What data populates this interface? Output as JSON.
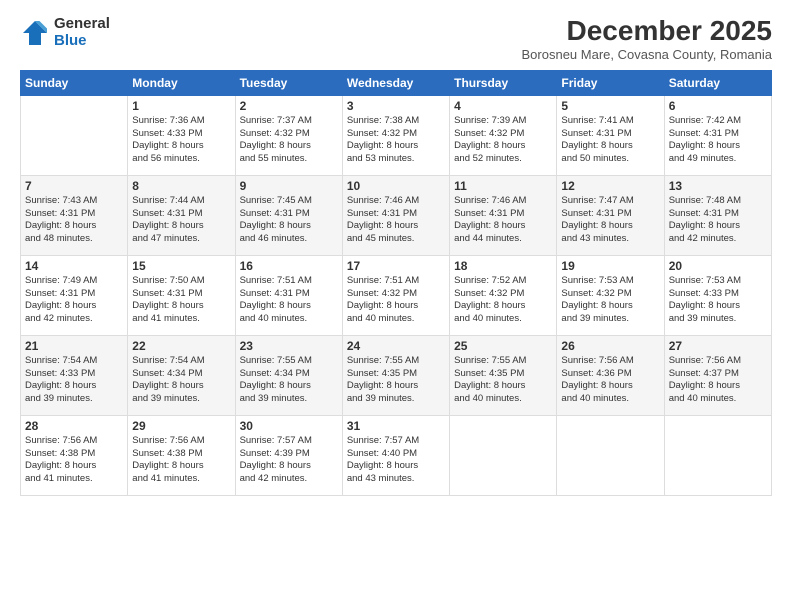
{
  "logo": {
    "general": "General",
    "blue": "Blue"
  },
  "header": {
    "month": "December 2025",
    "location": "Borosneu Mare, Covasna County, Romania"
  },
  "weekdays": [
    "Sunday",
    "Monday",
    "Tuesday",
    "Wednesday",
    "Thursday",
    "Friday",
    "Saturday"
  ],
  "weeks": [
    [
      {
        "day": "",
        "info": ""
      },
      {
        "day": "1",
        "info": "Sunrise: 7:36 AM\nSunset: 4:33 PM\nDaylight: 8 hours\nand 56 minutes."
      },
      {
        "day": "2",
        "info": "Sunrise: 7:37 AM\nSunset: 4:32 PM\nDaylight: 8 hours\nand 55 minutes."
      },
      {
        "day": "3",
        "info": "Sunrise: 7:38 AM\nSunset: 4:32 PM\nDaylight: 8 hours\nand 53 minutes."
      },
      {
        "day": "4",
        "info": "Sunrise: 7:39 AM\nSunset: 4:32 PM\nDaylight: 8 hours\nand 52 minutes."
      },
      {
        "day": "5",
        "info": "Sunrise: 7:41 AM\nSunset: 4:31 PM\nDaylight: 8 hours\nand 50 minutes."
      },
      {
        "day": "6",
        "info": "Sunrise: 7:42 AM\nSunset: 4:31 PM\nDaylight: 8 hours\nand 49 minutes."
      }
    ],
    [
      {
        "day": "7",
        "info": "Sunrise: 7:43 AM\nSunset: 4:31 PM\nDaylight: 8 hours\nand 48 minutes."
      },
      {
        "day": "8",
        "info": "Sunrise: 7:44 AM\nSunset: 4:31 PM\nDaylight: 8 hours\nand 47 minutes."
      },
      {
        "day": "9",
        "info": "Sunrise: 7:45 AM\nSunset: 4:31 PM\nDaylight: 8 hours\nand 46 minutes."
      },
      {
        "day": "10",
        "info": "Sunrise: 7:46 AM\nSunset: 4:31 PM\nDaylight: 8 hours\nand 45 minutes."
      },
      {
        "day": "11",
        "info": "Sunrise: 7:46 AM\nSunset: 4:31 PM\nDaylight: 8 hours\nand 44 minutes."
      },
      {
        "day": "12",
        "info": "Sunrise: 7:47 AM\nSunset: 4:31 PM\nDaylight: 8 hours\nand 43 minutes."
      },
      {
        "day": "13",
        "info": "Sunrise: 7:48 AM\nSunset: 4:31 PM\nDaylight: 8 hours\nand 42 minutes."
      }
    ],
    [
      {
        "day": "14",
        "info": "Sunrise: 7:49 AM\nSunset: 4:31 PM\nDaylight: 8 hours\nand 42 minutes."
      },
      {
        "day": "15",
        "info": "Sunrise: 7:50 AM\nSunset: 4:31 PM\nDaylight: 8 hours\nand 41 minutes."
      },
      {
        "day": "16",
        "info": "Sunrise: 7:51 AM\nSunset: 4:31 PM\nDaylight: 8 hours\nand 40 minutes."
      },
      {
        "day": "17",
        "info": "Sunrise: 7:51 AM\nSunset: 4:32 PM\nDaylight: 8 hours\nand 40 minutes."
      },
      {
        "day": "18",
        "info": "Sunrise: 7:52 AM\nSunset: 4:32 PM\nDaylight: 8 hours\nand 40 minutes."
      },
      {
        "day": "19",
        "info": "Sunrise: 7:53 AM\nSunset: 4:32 PM\nDaylight: 8 hours\nand 39 minutes."
      },
      {
        "day": "20",
        "info": "Sunrise: 7:53 AM\nSunset: 4:33 PM\nDaylight: 8 hours\nand 39 minutes."
      }
    ],
    [
      {
        "day": "21",
        "info": "Sunrise: 7:54 AM\nSunset: 4:33 PM\nDaylight: 8 hours\nand 39 minutes."
      },
      {
        "day": "22",
        "info": "Sunrise: 7:54 AM\nSunset: 4:34 PM\nDaylight: 8 hours\nand 39 minutes."
      },
      {
        "day": "23",
        "info": "Sunrise: 7:55 AM\nSunset: 4:34 PM\nDaylight: 8 hours\nand 39 minutes."
      },
      {
        "day": "24",
        "info": "Sunrise: 7:55 AM\nSunset: 4:35 PM\nDaylight: 8 hours\nand 39 minutes."
      },
      {
        "day": "25",
        "info": "Sunrise: 7:55 AM\nSunset: 4:35 PM\nDaylight: 8 hours\nand 40 minutes."
      },
      {
        "day": "26",
        "info": "Sunrise: 7:56 AM\nSunset: 4:36 PM\nDaylight: 8 hours\nand 40 minutes."
      },
      {
        "day": "27",
        "info": "Sunrise: 7:56 AM\nSunset: 4:37 PM\nDaylight: 8 hours\nand 40 minutes."
      }
    ],
    [
      {
        "day": "28",
        "info": "Sunrise: 7:56 AM\nSunset: 4:38 PM\nDaylight: 8 hours\nand 41 minutes."
      },
      {
        "day": "29",
        "info": "Sunrise: 7:56 AM\nSunset: 4:38 PM\nDaylight: 8 hours\nand 41 minutes."
      },
      {
        "day": "30",
        "info": "Sunrise: 7:57 AM\nSunset: 4:39 PM\nDaylight: 8 hours\nand 42 minutes."
      },
      {
        "day": "31",
        "info": "Sunrise: 7:57 AM\nSunset: 4:40 PM\nDaylight: 8 hours\nand 43 minutes."
      },
      {
        "day": "",
        "info": ""
      },
      {
        "day": "",
        "info": ""
      },
      {
        "day": "",
        "info": ""
      }
    ]
  ]
}
